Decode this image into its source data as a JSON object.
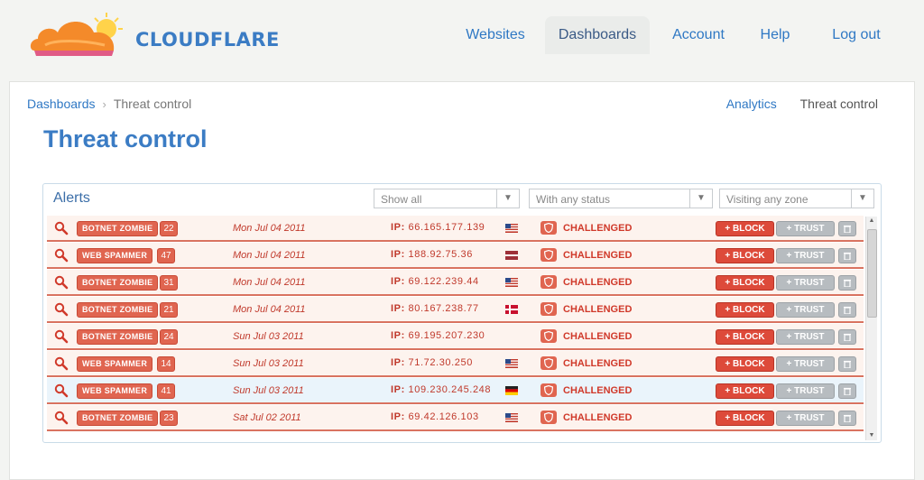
{
  "brand": {
    "name": "CLOUDFLARE"
  },
  "nav": [
    {
      "label": "Websites",
      "active": false
    },
    {
      "label": "Dashboards",
      "active": true
    },
    {
      "label": "Account",
      "active": false
    },
    {
      "label": "Help",
      "active": false
    },
    {
      "label": "Log out",
      "active": false
    }
  ],
  "breadcrumb": {
    "parent": "Dashboards",
    "separator": "›",
    "current": "Threat control"
  },
  "subnav": {
    "analytics": "Analytics",
    "threat_control": "Threat control"
  },
  "page_title": "Threat control",
  "alerts": {
    "title": "Alerts",
    "filters": [
      {
        "selected": "Show all"
      },
      {
        "selected": "With any status"
      },
      {
        "selected": "Visiting any zone"
      }
    ],
    "actions": {
      "block": "+ BLOCK",
      "trust": "+ TRUST"
    },
    "rows": [
      {
        "type": "BOTNET ZOMBIE",
        "count": "22",
        "date": "Mon Jul 04 2011",
        "ip_label": "IP:",
        "ip": "66.165.177.139",
        "flag": "us-flag-icon",
        "status": "CHALLENGED"
      },
      {
        "type": "WEB SPAMMER",
        "count": "47",
        "date": "Mon Jul 04 2011",
        "ip_label": "IP:",
        "ip": "188.92.75.36",
        "flag": "lv-flag-icon",
        "status": "CHALLENGED"
      },
      {
        "type": "BOTNET ZOMBIE",
        "count": "31",
        "date": "Mon Jul 04 2011",
        "ip_label": "IP:",
        "ip": "69.122.239.44",
        "flag": "us-flag-icon",
        "status": "CHALLENGED"
      },
      {
        "type": "BOTNET ZOMBIE",
        "count": "21",
        "date": "Mon Jul 04 2011",
        "ip_label": "IP:",
        "ip": "80.167.238.77",
        "flag": "dk-flag-icon",
        "status": "CHALLENGED"
      },
      {
        "type": "BOTNET ZOMBIE",
        "count": "24",
        "date": "Sun Jul 03 2011",
        "ip_label": "IP:",
        "ip": "69.195.207.230",
        "flag": "",
        "status": "CHALLENGED"
      },
      {
        "type": "WEB SPAMMER",
        "count": "14",
        "date": "Sun Jul 03 2011",
        "ip_label": "IP:",
        "ip": "71.72.30.250",
        "flag": "us-flag-icon",
        "status": "CHALLENGED"
      },
      {
        "type": "WEB SPAMMER",
        "count": "41",
        "date": "Sun Jul 03 2011",
        "ip_label": "IP:",
        "ip": "109.230.245.248",
        "flag": "de-flag-icon",
        "status": "CHALLENGED"
      },
      {
        "type": "BOTNET ZOMBIE",
        "count": "23",
        "date": "Sat Jul 02 2011",
        "ip_label": "IP:",
        "ip": "69.42.126.103",
        "flag": "us-flag-icon",
        "status": "CHALLENGED"
      }
    ]
  },
  "colors": {
    "brand_blue": "#3b7cc4",
    "alert_red": "#e06550",
    "block_red": "#dd4a3a",
    "trust_gray": "#b7bcc0"
  }
}
